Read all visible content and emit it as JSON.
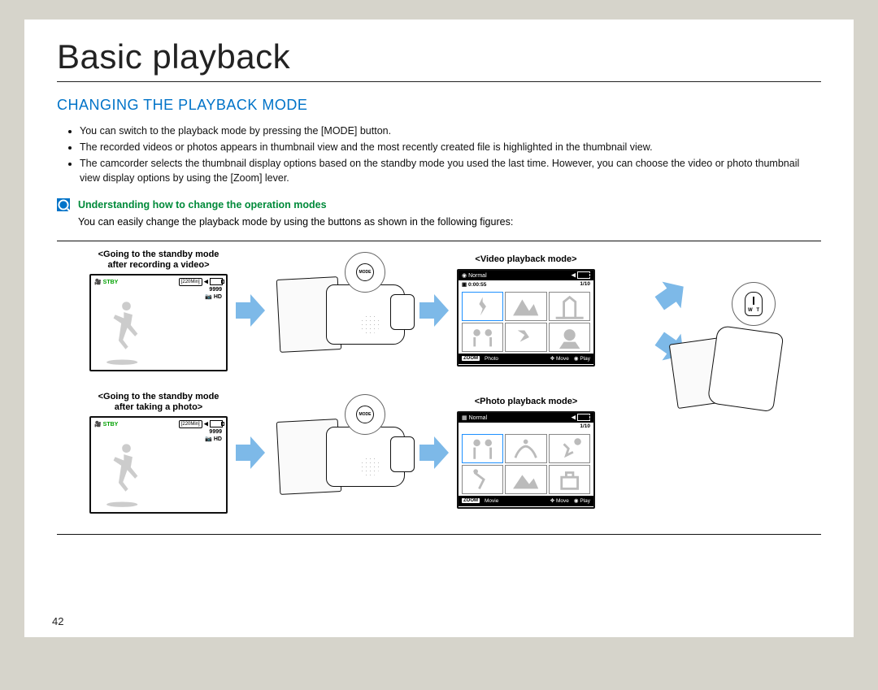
{
  "page_number": "42",
  "title": "Basic playback",
  "section_heading": "CHANGING THE PLAYBACK MODE",
  "bullets": [
    "You can switch to the playback mode by pressing the [MODE] button.",
    "The recorded videos or photos appears in thumbnail view and the most recently created file is highlighted in the thumbnail view.",
    "The camcorder selects the thumbnail display options based on the standby mode you used the last time. However, you can choose the video or photo thumbnail view display options by using the [Zoom] lever."
  ],
  "note": {
    "icon_glyph": "Q",
    "subheading": "Understanding how to change the operation modes",
    "body": "You can easily change the playback mode by using the buttons as shown in the following figures:"
  },
  "labels": {
    "standby_video": "<Going to the standby mode after recording a video>",
    "standby_photo": "<Going to the standby mode after taking a photo>",
    "video_playback": "<Video playback mode>",
    "photo_playback": "<Photo playback mode>"
  },
  "lcd": {
    "stby": "STBY",
    "time_remaining": "[220Min]",
    "photo_count": "9999",
    "quality": "HD"
  },
  "mode_button": "MODE",
  "zoom": {
    "w": "W",
    "t": "T"
  },
  "thumb_top": {
    "normal": "Normal",
    "timecode": "0:00:55",
    "counter": "1/10"
  },
  "thumb_bottom_video": {
    "zoom_label": "ZOOM",
    "zoom_text": "Photo",
    "move": "Move",
    "play": "Play"
  },
  "thumb_bottom_photo": {
    "zoom_label": "ZOOM",
    "zoom_text": "Movie",
    "move": "Move",
    "play": "Play"
  }
}
